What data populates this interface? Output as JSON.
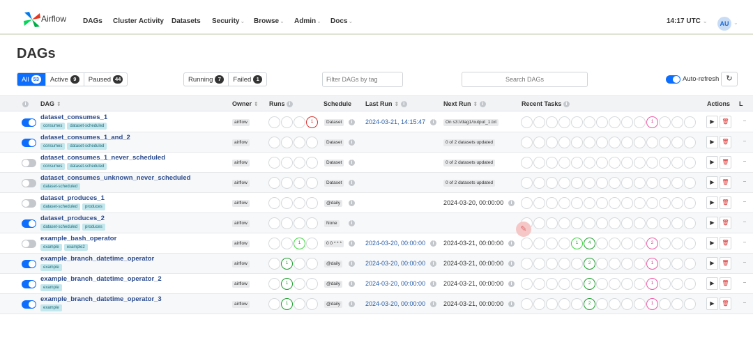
{
  "app": {
    "brand": "Airflow"
  },
  "nav": [
    "DAGs",
    "Cluster Activity",
    "Datasets",
    "Security",
    "Browse",
    "Admin",
    "Docs"
  ],
  "header": {
    "time": "14:17 UTC",
    "user_initials": "AU"
  },
  "page": {
    "title": "DAGs"
  },
  "filters": {
    "status": [
      {
        "label": "All",
        "count": "53"
      },
      {
        "label": "Active",
        "count": "9"
      },
      {
        "label": "Paused",
        "count": "44"
      }
    ],
    "run_state": [
      {
        "label": "Running",
        "count": "7"
      },
      {
        "label": "Failed",
        "count": "1"
      }
    ],
    "tag_placeholder": "Filter DAGs by tag",
    "search_placeholder": "Search DAGs",
    "auto_refresh": "Auto-refresh",
    "auto_refresh_on": true,
    "refresh_icon": "refresh-icon"
  },
  "table": {
    "headers": {
      "dag": "DAG",
      "owner": "Owner",
      "runs": "Runs",
      "schedule": "Schedule",
      "last_run": "Last Run",
      "next_run": "Next Run",
      "recent_tasks": "Recent Tasks",
      "actions": "Actions",
      "links": "L"
    },
    "rows": [
      {
        "dag_id": "dataset_consumes_1",
        "tags": [
          "consumes",
          "dataset-scheduled"
        ],
        "active": true,
        "owner": "airflow",
        "schedule": "Dataset",
        "last_run": "2024-03-21, 14:15:47",
        "next_run": "",
        "next_badge": "On s3://dag1/output_1.txt"
      },
      {
        "dag_id": "dataset_consumes_1_and_2",
        "tags": [
          "consumes",
          "dataset-scheduled"
        ],
        "active": true,
        "owner": "airflow",
        "schedule": "Dataset",
        "last_run": "",
        "next_run": "",
        "next_badge": "0 of 2 datasets updated"
      },
      {
        "dag_id": "dataset_consumes_1_never_scheduled",
        "tags": [
          "consumes",
          "dataset-scheduled"
        ],
        "active": false,
        "owner": "airflow",
        "schedule": "Dataset",
        "last_run": "",
        "next_run": "",
        "next_badge": "0 of 2 datasets updated"
      },
      {
        "dag_id": "dataset_consumes_unknown_never_scheduled",
        "tags": [
          "dataset-scheduled"
        ],
        "active": false,
        "owner": "airflow",
        "schedule": "Dataset",
        "last_run": "",
        "next_run": "",
        "next_badge": "0 of 2 datasets updated"
      },
      {
        "dag_id": "dataset_produces_1",
        "tags": [
          "dataset-scheduled",
          "produces"
        ],
        "active": false,
        "owner": "airflow",
        "schedule": "@daily",
        "last_run": "",
        "next_run": "2024-03-20, 00:00:00",
        "next_badge": ""
      },
      {
        "dag_id": "dataset_produces_2",
        "tags": [
          "dataset-scheduled",
          "produces"
        ],
        "active": true,
        "owner": "airflow",
        "schedule": "None",
        "last_run": "",
        "next_run": "",
        "next_badge": ""
      },
      {
        "dag_id": "example_bash_operator",
        "tags": [
          "example",
          "example2"
        ],
        "active": false,
        "owner": "airflow",
        "schedule": "0 0 * * *",
        "last_run": "2024-03-20, 00:00:00",
        "next_run": "2024-03-21, 00:00:00",
        "next_badge": ""
      },
      {
        "dag_id": "example_branch_datetime_operator",
        "tags": [
          "example"
        ],
        "active": true,
        "owner": "airflow",
        "schedule": "@daily",
        "last_run": "2024-03-20, 00:00:00",
        "next_run": "2024-03-21, 00:00:00",
        "next_badge": ""
      },
      {
        "dag_id": "example_branch_datetime_operator_2",
        "tags": [
          "example"
        ],
        "active": true,
        "owner": "airflow",
        "schedule": "@daily",
        "last_run": "2024-03-20, 00:00:00",
        "next_run": "2024-03-21, 00:00:00",
        "next_badge": ""
      },
      {
        "dag_id": "example_branch_datetime_operator_3",
        "tags": [
          "example"
        ],
        "active": true,
        "owner": "airflow",
        "schedule": "@daily",
        "last_run": "2024-03-20, 00:00:00",
        "next_run": "2024-03-21, 00:00:00",
        "next_badge": ""
      }
    ],
    "runs": [
      [
        {
          "i": 3,
          "s": "red",
          "t": "1"
        }
      ],
      [],
      [],
      [],
      [],
      [],
      [
        {
          "i": 2,
          "s": "lime",
          "t": "1"
        }
      ],
      [
        {
          "i": 1,
          "s": "green",
          "t": "1"
        }
      ],
      [
        {
          "i": 1,
          "s": "green",
          "t": "1"
        }
      ],
      [
        {
          "i": 1,
          "s": "green",
          "t": "1"
        }
      ]
    ],
    "tasks": [
      [
        {
          "i": 10,
          "s": "pink",
          "t": "1"
        }
      ],
      [],
      [],
      [],
      [],
      [],
      [
        {
          "i": 4,
          "s": "lime",
          "t": "1"
        },
        {
          "i": 5,
          "s": "green",
          "t": "4"
        },
        {
          "i": 10,
          "s": "pink",
          "t": "2"
        }
      ],
      [
        {
          "i": 5,
          "s": "green",
          "t": "2"
        },
        {
          "i": 10,
          "s": "pink",
          "t": "1"
        }
      ],
      [
        {
          "i": 5,
          "s": "green",
          "t": "2"
        },
        {
          "i": 10,
          "s": "pink",
          "t": "1"
        }
      ],
      [
        {
          "i": 5,
          "s": "green",
          "t": "2"
        },
        {
          "i": 10,
          "s": "pink",
          "t": "1"
        }
      ]
    ]
  },
  "colors": {
    "accent": "#0d6efd",
    "dag_link": "#2a4a8c",
    "tag_bg": "#c3e7ed",
    "success": "#1f9d2f",
    "failed": "#d9302f",
    "up_for_retry": "#ee5aa6"
  }
}
